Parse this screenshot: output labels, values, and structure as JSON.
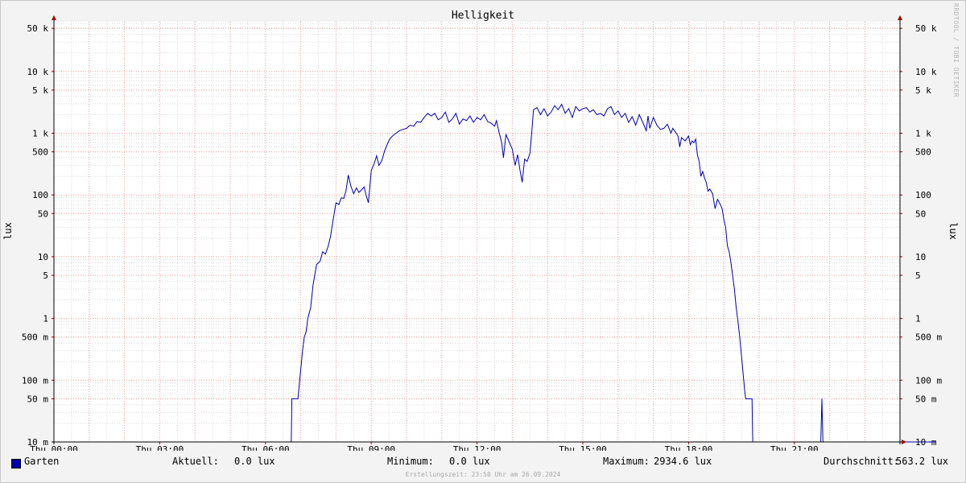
{
  "chart_data": {
    "type": "line",
    "title": "Helligkeit",
    "ylabel": "lux",
    "y_scale": "log",
    "ylim": [
      0.01,
      60000
    ],
    "xlim": [
      0,
      25
    ],
    "x_unit": "hours",
    "x_ticks": [
      {
        "value": 0,
        "label": "Thu 00:00"
      },
      {
        "value": 3,
        "label": "Thu 03:00"
      },
      {
        "value": 6,
        "label": "Thu 06:00"
      },
      {
        "value": 9,
        "label": "Thu 09:00"
      },
      {
        "value": 12,
        "label": "Thu 12:00"
      },
      {
        "value": 15,
        "label": "Thu 15:00"
      },
      {
        "value": 18,
        "label": "Thu 18:00"
      },
      {
        "value": 21,
        "label": "Thu 21:00"
      }
    ],
    "y_ticks": [
      {
        "value": 0.01,
        "label": "10 m"
      },
      {
        "value": 0.05,
        "label": "50 m"
      },
      {
        "value": 0.1,
        "label": "100 m"
      },
      {
        "value": 0.5,
        "label": "500 m"
      },
      {
        "value": 1,
        "label": "1"
      },
      {
        "value": 5,
        "label": "5"
      },
      {
        "value": 10,
        "label": "10"
      },
      {
        "value": 50,
        "label": "50"
      },
      {
        "value": 100,
        "label": "100"
      },
      {
        "value": 500,
        "label": "500"
      },
      {
        "value": 1000,
        "label": "1 k"
      },
      {
        "value": 5000,
        "label": "5 k"
      },
      {
        "value": 10000,
        "label": "10 k"
      },
      {
        "value": 50000,
        "label": "50 k"
      }
    ],
    "grid": true,
    "legend_position": "bottom-left",
    "series": [
      {
        "name": "Garten",
        "color": "#0000aa",
        "points": [
          [
            0,
            0.01
          ],
          [
            6.73,
            0.01
          ],
          [
            6.75,
            0.05
          ],
          [
            6.92,
            0.05
          ],
          [
            6.97,
            0.1
          ],
          [
            7.0,
            0.15
          ],
          [
            7.05,
            0.3
          ],
          [
            7.1,
            0.5
          ],
          [
            7.15,
            0.6
          ],
          [
            7.2,
            1.0
          ],
          [
            7.28,
            1.5
          ],
          [
            7.35,
            3.5
          ],
          [
            7.45,
            7.5
          ],
          [
            7.55,
            8.5
          ],
          [
            7.62,
            12
          ],
          [
            7.7,
            11
          ],
          [
            7.78,
            15
          ],
          [
            7.85,
            22
          ],
          [
            7.92,
            40
          ],
          [
            8.0,
            75
          ],
          [
            8.08,
            70
          ],
          [
            8.15,
            90
          ],
          [
            8.22,
            88
          ],
          [
            8.28,
            115
          ],
          [
            8.35,
            210
          ],
          [
            8.42,
            140
          ],
          [
            8.5,
            105
          ],
          [
            8.58,
            130
          ],
          [
            8.65,
            110
          ],
          [
            8.72,
            120
          ],
          [
            8.8,
            135
          ],
          [
            8.85,
            100
          ],
          [
            8.92,
            75
          ],
          [
            9.0,
            250
          ],
          [
            9.08,
            320
          ],
          [
            9.15,
            430
          ],
          [
            9.22,
            300
          ],
          [
            9.3,
            360
          ],
          [
            9.38,
            520
          ],
          [
            9.45,
            650
          ],
          [
            9.52,
            800
          ],
          [
            9.6,
            900
          ],
          [
            9.7,
            1000
          ],
          [
            9.8,
            1100
          ],
          [
            9.9,
            1150
          ],
          [
            10.0,
            1200
          ],
          [
            10.1,
            1350
          ],
          [
            10.2,
            1300
          ],
          [
            10.3,
            1550
          ],
          [
            10.4,
            1500
          ],
          [
            10.5,
            1800
          ],
          [
            10.6,
            2100
          ],
          [
            10.7,
            1900
          ],
          [
            10.8,
            2100
          ],
          [
            10.9,
            1650
          ],
          [
            11.0,
            1800
          ],
          [
            11.1,
            2200
          ],
          [
            11.2,
            1500
          ],
          [
            11.3,
            1700
          ],
          [
            11.4,
            2100
          ],
          [
            11.5,
            1400
          ],
          [
            11.6,
            1700
          ],
          [
            11.7,
            1600
          ],
          [
            11.8,
            1900
          ],
          [
            11.9,
            1500
          ],
          [
            12.0,
            1800
          ],
          [
            12.1,
            1650
          ],
          [
            12.2,
            2000
          ],
          [
            12.3,
            1550
          ],
          [
            12.4,
            1450
          ],
          [
            12.5,
            1300
          ],
          [
            12.55,
            1600
          ],
          [
            12.62,
            1050
          ],
          [
            12.7,
            700
          ],
          [
            12.75,
            400
          ],
          [
            12.82,
            950
          ],
          [
            12.9,
            750
          ],
          [
            13.0,
            550
          ],
          [
            13.08,
            300
          ],
          [
            13.15,
            450
          ],
          [
            13.22,
            250
          ],
          [
            13.28,
            160
          ],
          [
            13.35,
            380
          ],
          [
            13.42,
            350
          ],
          [
            13.5,
            470
          ],
          [
            13.55,
            1000
          ],
          [
            13.6,
            2400
          ],
          [
            13.7,
            2600
          ],
          [
            13.8,
            2000
          ],
          [
            13.9,
            2500
          ],
          [
            14.0,
            1900
          ],
          [
            14.1,
            2200
          ],
          [
            14.2,
            2800
          ],
          [
            14.3,
            2400
          ],
          [
            14.4,
            2934.6
          ],
          [
            14.5,
            2100
          ],
          [
            14.6,
            2500
          ],
          [
            14.7,
            1800
          ],
          [
            14.8,
            2700
          ],
          [
            14.9,
            2300
          ],
          [
            15.0,
            2500
          ],
          [
            15.1,
            2600
          ],
          [
            15.2,
            2200
          ],
          [
            15.3,
            2400
          ],
          [
            15.4,
            2000
          ],
          [
            15.5,
            2100
          ],
          [
            15.6,
            1900
          ],
          [
            15.7,
            2500
          ],
          [
            15.8,
            2700
          ],
          [
            15.9,
            2000
          ],
          [
            16.0,
            2300
          ],
          [
            16.1,
            1800
          ],
          [
            16.2,
            2100
          ],
          [
            16.3,
            1500
          ],
          [
            16.4,
            1850
          ],
          [
            16.5,
            1350
          ],
          [
            16.6,
            2000
          ],
          [
            16.7,
            1500
          ],
          [
            16.8,
            1100
          ],
          [
            16.85,
            1900
          ],
          [
            16.9,
            1200
          ],
          [
            17.0,
            1800
          ],
          [
            17.1,
            1350
          ],
          [
            17.2,
            1150
          ],
          [
            17.3,
            1200
          ],
          [
            17.4,
            1400
          ],
          [
            17.5,
            1000
          ],
          [
            17.55,
            1200
          ],
          [
            17.6,
            1100
          ],
          [
            17.7,
            900
          ],
          [
            17.75,
            600
          ],
          [
            17.8,
            850
          ],
          [
            17.9,
            750
          ],
          [
            18.0,
            900
          ],
          [
            18.05,
            650
          ],
          [
            18.1,
            750
          ],
          [
            18.15,
            700
          ],
          [
            18.2,
            800
          ],
          [
            18.25,
            450
          ],
          [
            18.3,
            350
          ],
          [
            18.35,
            200
          ],
          [
            18.4,
            240
          ],
          [
            18.45,
            190
          ],
          [
            18.5,
            160
          ],
          [
            18.55,
            115
          ],
          [
            18.6,
            125
          ],
          [
            18.68,
            105
          ],
          [
            18.75,
            60
          ],
          [
            18.82,
            85
          ],
          [
            18.9,
            70
          ],
          [
            18.95,
            60
          ],
          [
            19.0,
            40
          ],
          [
            19.05,
            30
          ],
          [
            19.1,
            15
          ],
          [
            19.15,
            12
          ],
          [
            19.2,
            8
          ],
          [
            19.25,
            5
          ],
          [
            19.3,
            3
          ],
          [
            19.35,
            1.5
          ],
          [
            19.4,
            0.9
          ],
          [
            19.45,
            0.5
          ],
          [
            19.5,
            0.25
          ],
          [
            19.55,
            0.12
          ],
          [
            19.6,
            0.06
          ],
          [
            19.62,
            0.05
          ],
          [
            19.8,
            0.05
          ],
          [
            19.82,
            0.01
          ],
          [
            21.75,
            0.01
          ],
          [
            21.78,
            0.05
          ],
          [
            21.81,
            0.01
          ],
          [
            25,
            0.01
          ]
        ]
      }
    ],
    "stats": {
      "current": {
        "label": "Aktuell:",
        "value": "0.0 lux"
      },
      "minimum": {
        "label": "Minimum:",
        "value": "0.0 lux"
      },
      "maximum": {
        "label": "Maximum:",
        "value": "2934.6 lux"
      },
      "average": {
        "label": "Durchschnitt:",
        "value": "563.2 lux"
      }
    }
  },
  "vendor_text": "RRDTOOL / TOBI OETIKER",
  "footer": "Erstellungszeit: 23:58 Uhr am 26.09.2024",
  "colors": {
    "background": "#f3f3f3",
    "plot_background": "#ffffff",
    "major_grid": "#e8a0a0",
    "minor_grid": "#d8d8d8",
    "series": "#0000aa",
    "axis_arrow": "#a00000"
  }
}
